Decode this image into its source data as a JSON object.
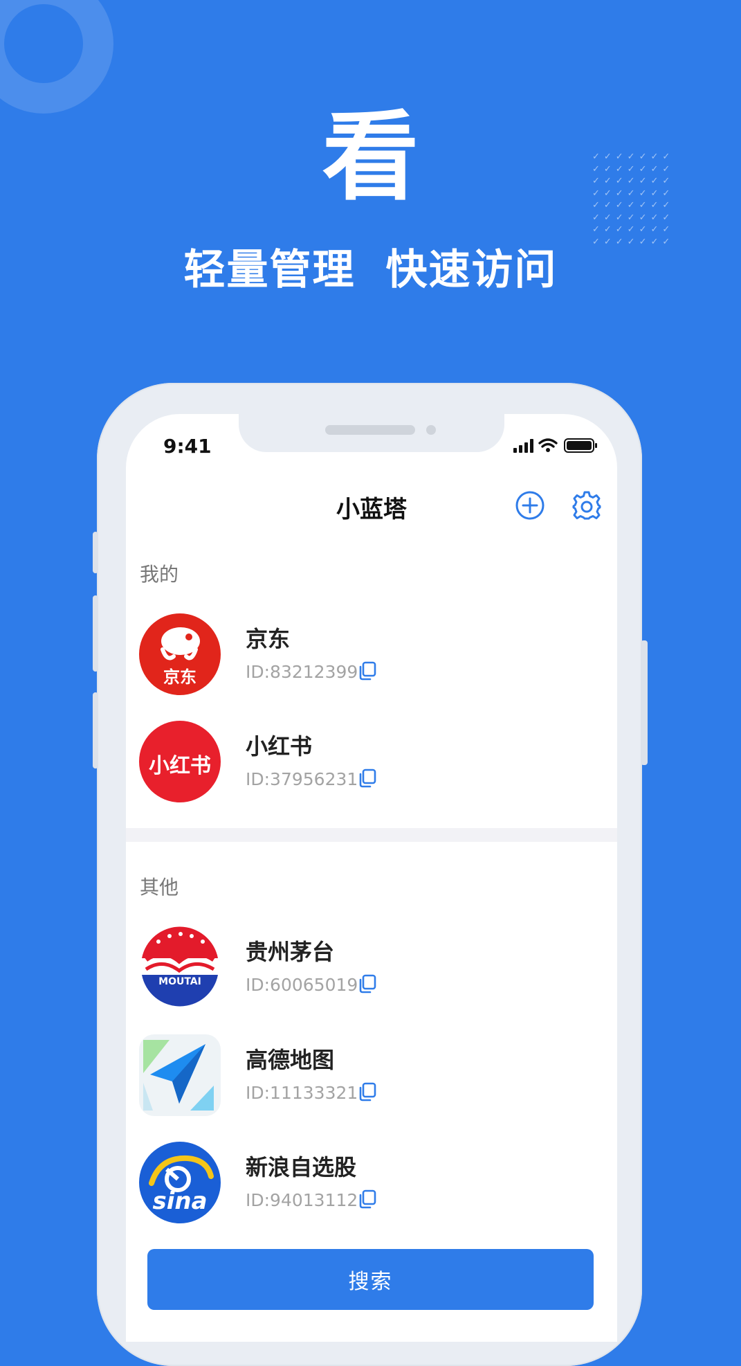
{
  "hero": {
    "big_char": "看",
    "slogan_1": "轻量管理",
    "slogan_2": "快速访问"
  },
  "status_bar": {
    "time": "9:41"
  },
  "header": {
    "title": "小蓝塔",
    "add_icon": "plus-circle-icon",
    "settings_icon": "gear-icon"
  },
  "sections": {
    "mine": "我的",
    "others": "其他"
  },
  "items": [
    {
      "name": "京东",
      "id": "ID:83212399",
      "logo_text": "京东",
      "logo_color": "#e1251b"
    },
    {
      "name": "小红书",
      "id": "ID:37956231",
      "logo_text": "小红书",
      "logo_color": "#e8202c"
    },
    {
      "name": "贵州茅台",
      "id": "ID:60065019",
      "logo_text": "MOUTAI",
      "logo_color": "#1f3fb0"
    },
    {
      "name": "高德地图",
      "id": "ID:11133321",
      "logo_text": "",
      "logo_color": "#1e8cf0"
    },
    {
      "name": "新浪自选股",
      "id": "ID:94013112",
      "logo_text": "sina",
      "logo_color": "#1a5fd6"
    }
  ],
  "search_button": "搜索",
  "colors": {
    "brand": "#2f7ce9",
    "text": "#222222",
    "muted": "#a3a3a3"
  }
}
